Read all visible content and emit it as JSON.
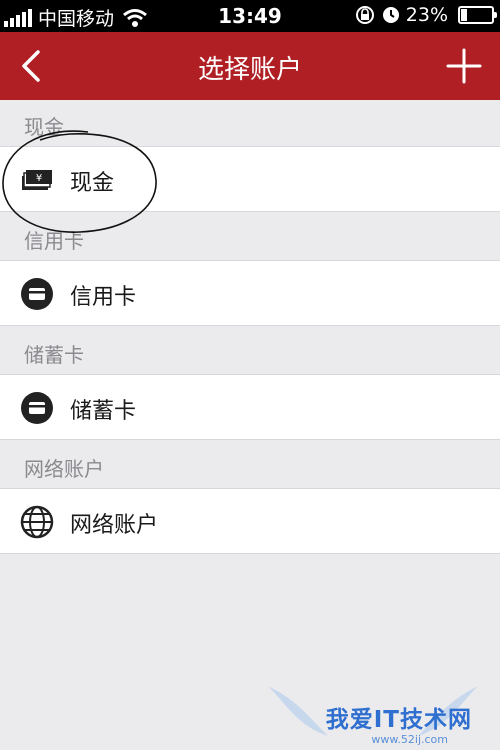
{
  "status_bar": {
    "carrier": "中国移动",
    "time": "13:49",
    "battery": "23%",
    "battery_level": 0.23
  },
  "nav": {
    "title": "选择账户"
  },
  "sections": [
    {
      "header": "现金",
      "item_label": "现金",
      "icon": "cash-icon"
    },
    {
      "header": "信用卡",
      "item_label": "信用卡",
      "icon": "card-icon"
    },
    {
      "header": "储蓄卡",
      "item_label": "储蓄卡",
      "icon": "card-icon"
    },
    {
      "header": "网络账户",
      "item_label": "网络账户",
      "icon": "globe-icon"
    }
  ],
  "watermark": {
    "title": "我爱IT技术网",
    "url": "www.52ij.com"
  },
  "colors": {
    "nav_background": "#b01f24",
    "page_background": "#ebebed"
  }
}
